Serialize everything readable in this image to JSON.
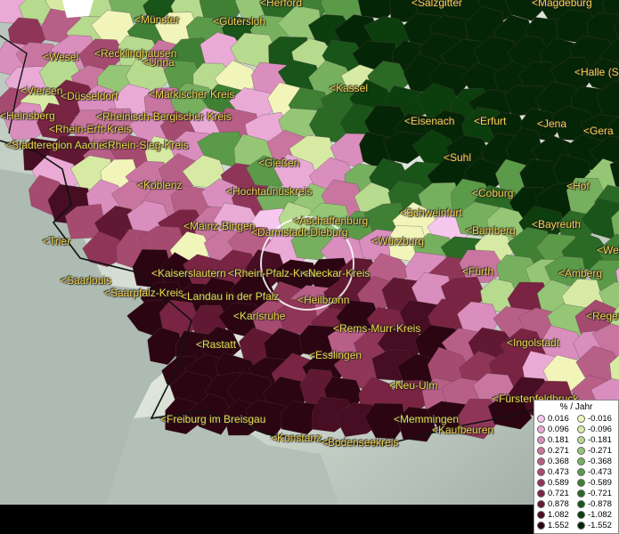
{
  "cities": [
    {
      "name": "<Münster"
    },
    {
      "name": "<Gütersloh"
    },
    {
      "name": "<Herford"
    },
    {
      "name": "<Salzgitter"
    },
    {
      "name": "<Magdeburg"
    },
    {
      "name": "<Wesel"
    },
    {
      "name": "<Recklinghausen"
    },
    {
      "name": "<Unna"
    },
    {
      "name": "<Viersen"
    },
    {
      "name": "<Düsseldorf"
    },
    {
      "name": "<Märkischer Kreis"
    },
    {
      "name": "<Kassel"
    },
    {
      "name": "<Halle (S"
    },
    {
      "name": "<Heinsberg"
    },
    {
      "name": "<Rheinisch-Bergischer Kreis"
    },
    {
      "name": "<Rhein-Erft-Kreis"
    },
    {
      "name": "<Eisenach"
    },
    {
      "name": "<Erfurt"
    },
    {
      "name": "<Jena"
    },
    {
      "name": "<Gera"
    },
    {
      "name": "<Städteregion Aachen"
    },
    {
      "name": "<Rhein-Sieg-Kreis"
    },
    {
      "name": "<Suhl"
    },
    {
      "name": "<Gießen"
    },
    {
      "name": "<Koblenz"
    },
    {
      "name": "<Hochtaunuskreis"
    },
    {
      "name": "<Coburg"
    },
    {
      "name": "<Hof"
    },
    {
      "name": "<Schweinfurt"
    },
    {
      "name": "<Aschaffenburg"
    },
    {
      "name": "<Mainz-Bingen"
    },
    {
      "name": "<Darmstadt-Dieburg"
    },
    {
      "name": "<Bayreuth"
    },
    {
      "name": "<Bamberg"
    },
    {
      "name": "<Würzburg"
    },
    {
      "name": "<Trier"
    },
    {
      "name": "<Weiden"
    },
    {
      "name": "<Kaiserslautern"
    },
    {
      "name": "<Rhein-Pfalz-Kreis"
    },
    {
      "name": "<Neckar-Kreis"
    },
    {
      "name": "<Fürth"
    },
    {
      "name": "<Amberg"
    },
    {
      "name": "<Saarlouis"
    },
    {
      "name": "<Saarpfalz-Kreis"
    },
    {
      "name": "<Landau in der Pfalz"
    },
    {
      "name": "<Heilbronn"
    },
    {
      "name": "<Karlsruhe"
    },
    {
      "name": "<Rems-Murr-Kreis"
    },
    {
      "name": "<Regensburg"
    },
    {
      "name": "<Rastatt"
    },
    {
      "name": "<Ingolstadt"
    },
    {
      "name": "<Esslingen"
    },
    {
      "name": "<Neu-Ulm"
    },
    {
      "name": "<Fürstenfeldbruck"
    },
    {
      "name": "<Freiburg im Breisgau"
    },
    {
      "name": "<Memmingen"
    },
    {
      "name": "<Kaufbeuren"
    },
    {
      "name": "<Konstanz"
    },
    {
      "name": "<Bodenseekreis"
    }
  ],
  "legend": {
    "title": "% / Jahr",
    "positive": [
      {
        "value": "0.016",
        "color": "#f7c8ee"
      },
      {
        "value": "0.096",
        "color": "#eaaad6"
      },
      {
        "value": "0.181",
        "color": "#d98ebd"
      },
      {
        "value": "0.271",
        "color": "#c8769f"
      },
      {
        "value": "0.368",
        "color": "#b85f88"
      },
      {
        "value": "0.473",
        "color": "#a64b70"
      },
      {
        "value": "0.589",
        "color": "#8f3658"
      },
      {
        "value": "0.721",
        "color": "#792443"
      },
      {
        "value": "0.878",
        "color": "#611832"
      },
      {
        "value": "1.082",
        "color": "#470d22"
      },
      {
        "value": "1.552",
        "color": "#2c0512"
      }
    ],
    "negative": [
      {
        "value": "-0.016",
        "color": "#f1f5b9"
      },
      {
        "value": "-0.096",
        "color": "#d6eaa4"
      },
      {
        "value": "-0.181",
        "color": "#b6da8e"
      },
      {
        "value": "-0.271",
        "color": "#94c676"
      },
      {
        "value": "-0.368",
        "color": "#76b05f"
      },
      {
        "value": "-0.473",
        "color": "#5b9a49"
      },
      {
        "value": "-0.589",
        "color": "#3f8034"
      },
      {
        "value": "-0.721",
        "color": "#2a6a24"
      },
      {
        "value": "-0.878",
        "color": "#195418"
      },
      {
        "value": "-1.082",
        "color": "#0c3d0d"
      },
      {
        "value": "-1.552",
        "color": "#052606"
      }
    ]
  },
  "colors": {
    "label_text": "#f2d24a",
    "land_base": "#c9d7c0",
    "sea_relief": "#a9b8b0",
    "border": "#222222"
  }
}
